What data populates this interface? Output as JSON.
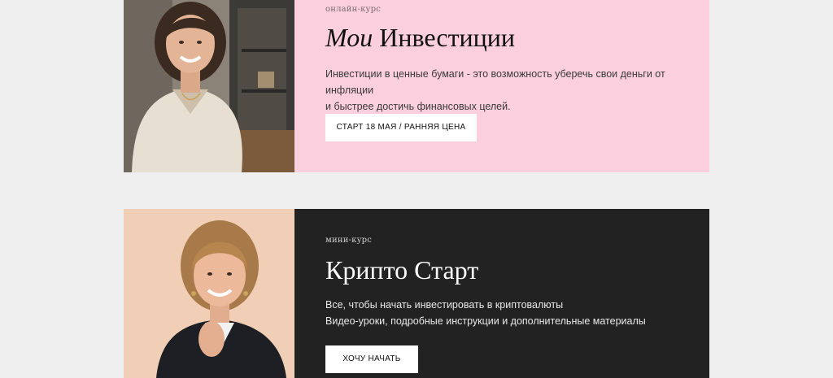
{
  "courses": [
    {
      "label": "онлайн-курс",
      "title_italic": "Мои",
      "title_rest": "Инвестиции",
      "desc_line1": "Инвестиции в ценные бумаги - это возможность уберечь свои деньги от инфляции",
      "desc_line2": "и быстрее достичь финансовых целей.",
      "button": "СТАРТ 18 МАЯ / РАННЯЯ ЦЕНА"
    },
    {
      "label": "мини-курс",
      "title": "Крипто Старт",
      "desc_line1": "Все, чтобы начать инвестировать в криптовалюты",
      "desc_line2": "Видео-уроки, подробные инструкции и дополнительные материалы",
      "button": "ХОЧУ НАЧАТЬ"
    }
  ],
  "colors": {
    "page_bg": "#efefef",
    "card1_bg": "#fccfde",
    "card2_bg": "#222222",
    "button_bg": "#ffffff"
  }
}
